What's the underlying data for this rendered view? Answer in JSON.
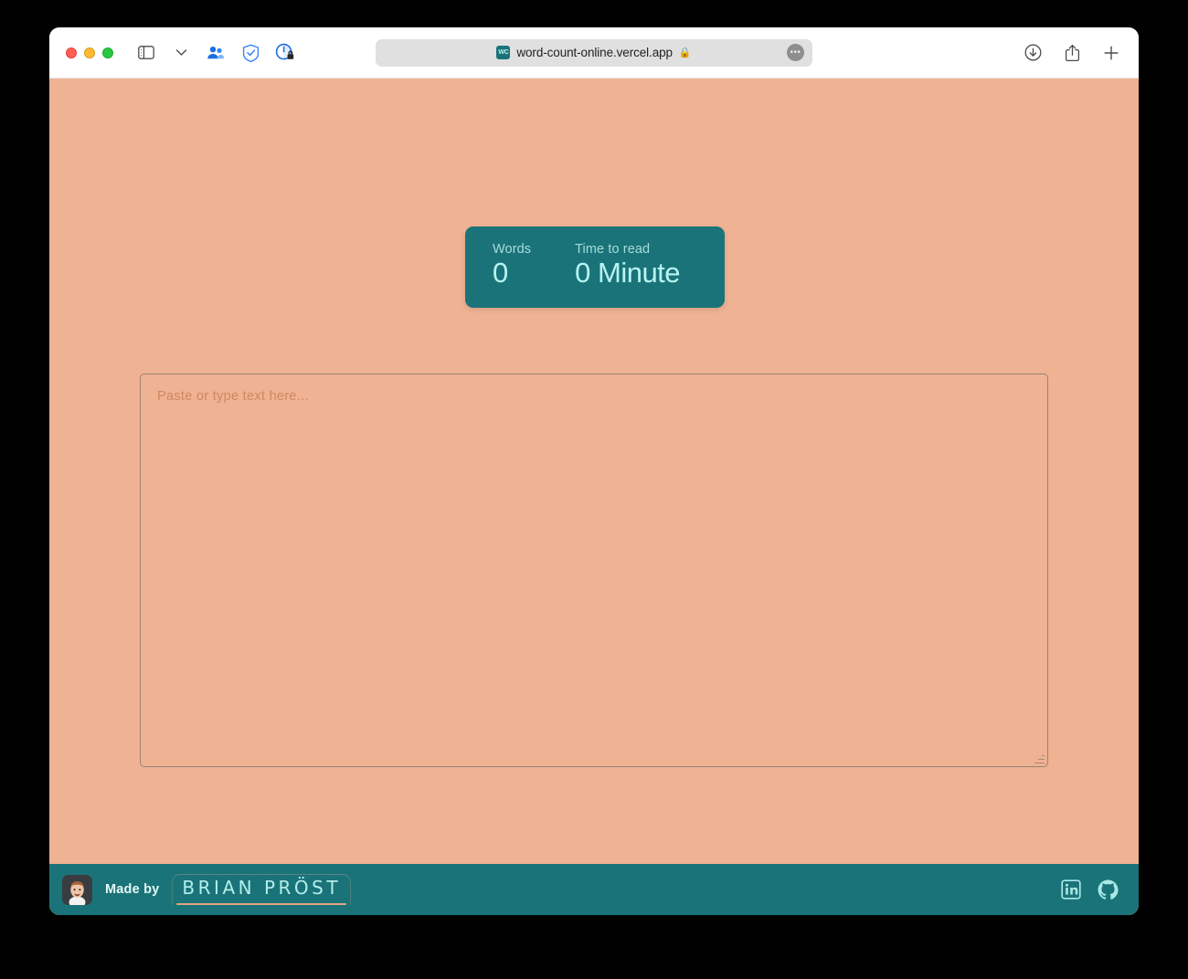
{
  "browser": {
    "traffic_lights": [
      "close",
      "minimize",
      "zoom"
    ],
    "toolbar_left_icons": [
      "sidebar-toggle-icon",
      "chevron-down-icon",
      "extension-people-icon",
      "adguard-shield-icon",
      "privacy-report-icon"
    ],
    "toolbar_right_icons": [
      "downloads-icon",
      "share-icon",
      "new-tab-icon"
    ],
    "address": {
      "favicon_label": "WC",
      "url": "word-count-online.vercel.app",
      "lock": "🔒",
      "page_menu": "•••"
    }
  },
  "page": {
    "background_color": "#efb293",
    "accent_color": "#1a7379",
    "stats": [
      {
        "label": "Words",
        "value": "0"
      },
      {
        "label": "Time to read",
        "value": "0 Minute"
      }
    ],
    "editor": {
      "placeholder": "Paste or type text here...",
      "value": ""
    }
  },
  "footer": {
    "avatar_alt": "brian-prost-avatar",
    "made_by_label": "Made by",
    "author_name": "BRIAN PRÖST",
    "social": [
      {
        "name": "linkedin-icon"
      },
      {
        "name": "github-icon"
      }
    ]
  }
}
